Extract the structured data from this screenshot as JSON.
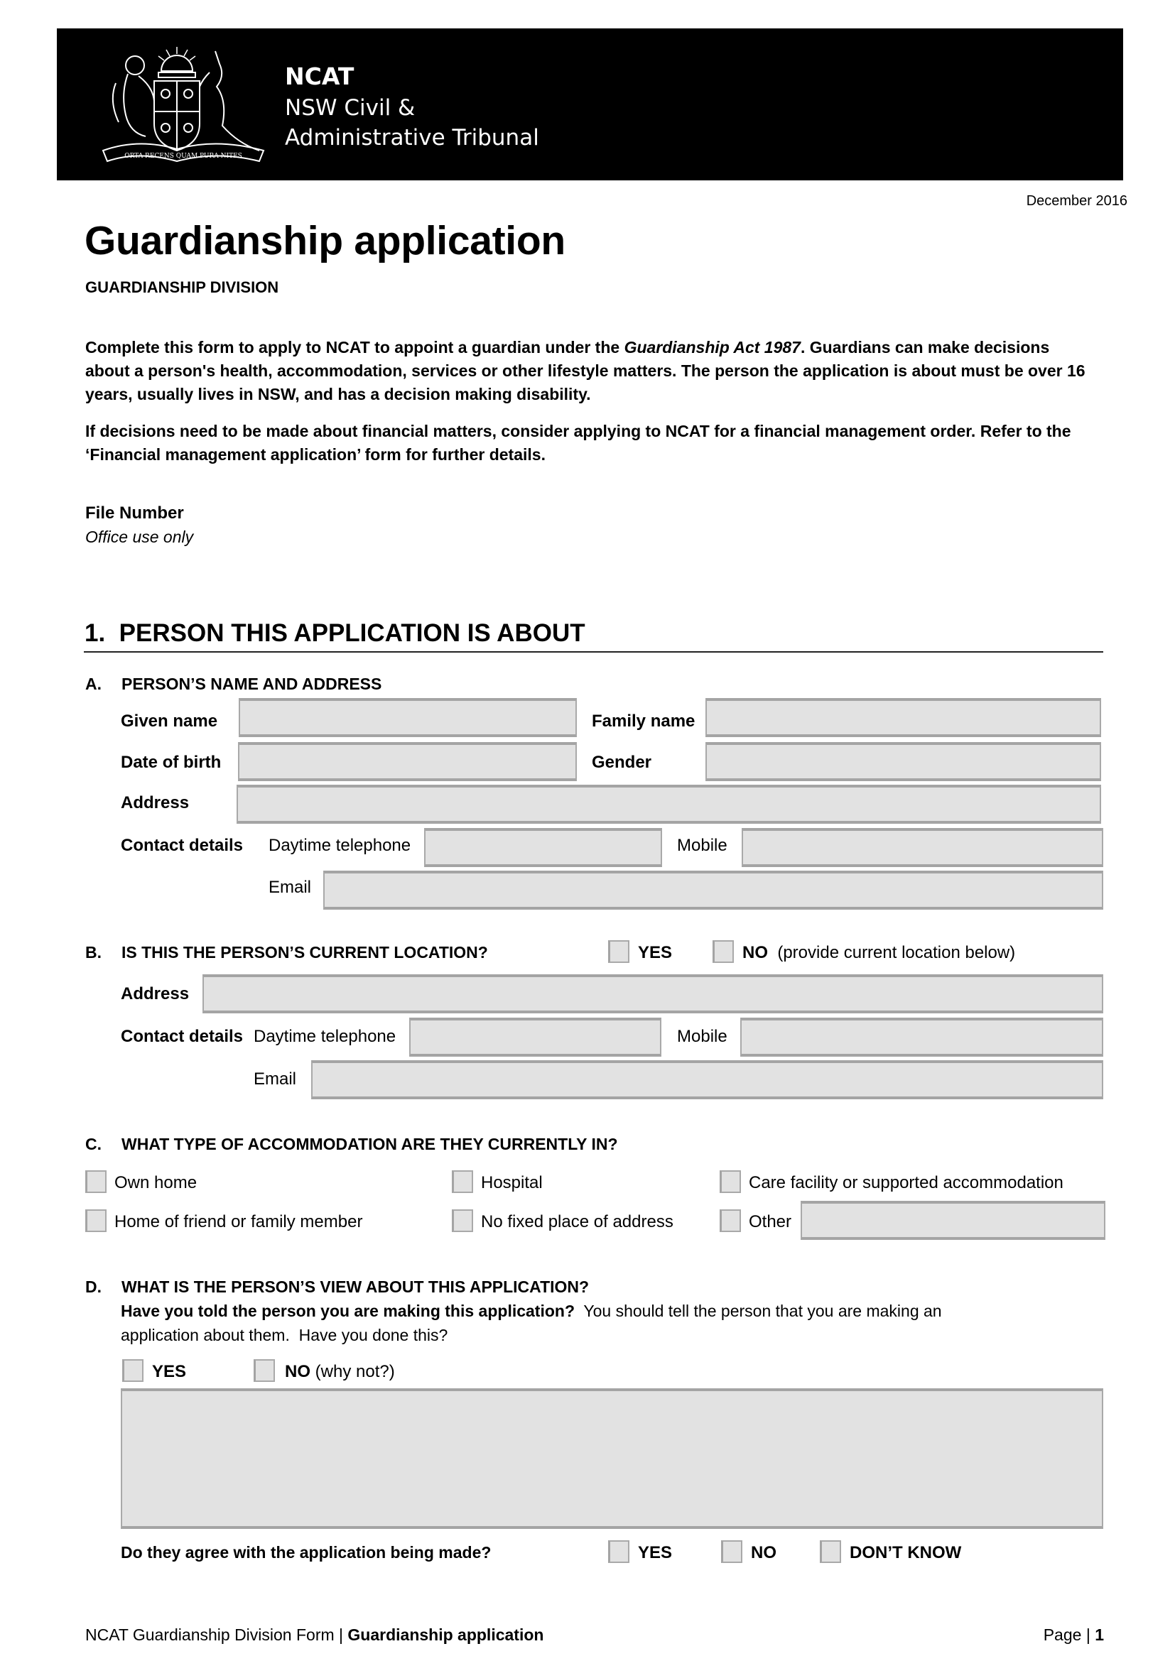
{
  "header": {
    "org_short": "NCAT",
    "org_line2": "NSW Civil &",
    "org_line3": "Administrative Tribunal",
    "crest_motto": "ORTA RECENS QUAM PURA NITES",
    "logo_icon": "nsw-coat-of-arms-icon"
  },
  "date": "December 2016",
  "title": "Guardianship application",
  "division": "GUARDIANSHIP DIVISION",
  "intro": {
    "para1_a": "Complete this form to apply to NCAT to appoint a guardian under the ",
    "para1_italic": "Guardianship Act 1987",
    "para1_b": ". Guardians can make decisions about a person's health, accommodation, services or other lifestyle matters. The person the application is about must be over 16 years, usually lives in NSW, and has a decision making disability.",
    "para2": "If decisions need to be made about financial matters, consider applying to NCAT for a financial management order. Refer to the ‘Financial management application’ form for further details."
  },
  "file_number": {
    "label": "File Number",
    "note": "Office use only",
    "value": ""
  },
  "section1": {
    "number": "1.",
    "heading": "PERSON THIS APPLICATION IS ABOUT",
    "A": {
      "letter": "A.",
      "heading": "PERSON’S NAME AND ADDRESS",
      "given_name_label": "Given name",
      "family_name_label": "Family name",
      "dob_label": "Date of birth",
      "gender_label": "Gender",
      "address_label": "Address",
      "contact_label": "Contact details",
      "daytime_label": "Daytime telephone",
      "mobile_label": "Mobile",
      "email_label": "Email",
      "values": {
        "given_name": "",
        "family_name": "",
        "dob": "",
        "gender": "",
        "address": "",
        "daytime": "",
        "mobile": "",
        "email": ""
      }
    },
    "B": {
      "letter": "B.",
      "heading": "IS THIS THE PERSON’S CURRENT LOCATION?",
      "yes_label": "YES",
      "no_label": "NO",
      "no_note": "(provide current location below)",
      "address_label": "Address",
      "contact_label": "Contact details",
      "daytime_label": "Daytime telephone",
      "mobile_label": "Mobile",
      "email_label": "Email",
      "yes_checked": false,
      "no_checked": false,
      "values": {
        "address": "",
        "daytime": "",
        "mobile": "",
        "email": ""
      }
    },
    "C": {
      "letter": "C.",
      "heading": "WHAT TYPE OF ACCOMMODATION ARE THEY CURRENTLY IN?",
      "options": [
        {
          "label": "Own home",
          "checked": false
        },
        {
          "label": "Hospital",
          "checked": false
        },
        {
          "label": "Care facility or supported accommodation",
          "checked": false
        },
        {
          "label": "Home of friend or family member",
          "checked": false
        },
        {
          "label": "No fixed place of address",
          "checked": false
        },
        {
          "label": "Other",
          "checked": false
        }
      ],
      "other_value": ""
    },
    "D": {
      "letter": "D.",
      "heading": "WHAT IS THE PERSON’S VIEW ABOUT THIS APPLICATION?",
      "question_bold": "Have you told the person you are making this application?",
      "question_rest": "  You should tell the person that you are making an",
      "question_line2": "application about them.  Have you done this?",
      "yes_label": "YES",
      "no_label": "NO",
      "no_note": "(why not?)",
      "why_not_value": "",
      "agree_question": "Do they agree with the application being made?",
      "agree_options": [
        {
          "label": "YES",
          "checked": false
        },
        {
          "label": "NO",
          "checked": false
        },
        {
          "label": "DON’T KNOW",
          "checked": false
        }
      ]
    }
  },
  "footer": {
    "left_normal": "NCAT Guardianship Division Form | ",
    "left_bold": "Guardianship application",
    "page_label": "Page | ",
    "page_number": "1"
  }
}
